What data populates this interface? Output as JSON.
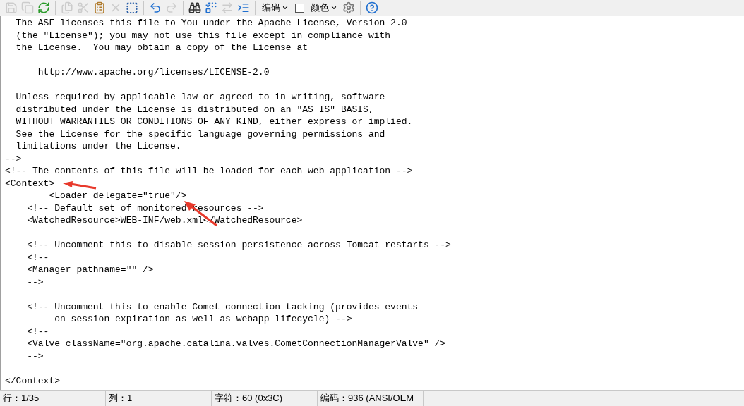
{
  "toolbar": [
    {
      "kind": "button",
      "disabled": true
    },
    {
      "kind": "button",
      "disabled": true
    },
    {
      "kind": "button",
      "disabled": false
    },
    {
      "kind": "separator"
    },
    {
      "kind": "button",
      "disabled": true
    },
    {
      "kind": "button",
      "disabled": true
    },
    {
      "kind": "button",
      "disabled": false
    },
    {
      "kind": "button",
      "disabled": true
    },
    {
      "kind": "button",
      "disabled": false
    },
    {
      "kind": "separator"
    },
    {
      "kind": "button",
      "disabled": false
    },
    {
      "kind": "button",
      "disabled": true
    },
    {
      "kind": "separator"
    },
    {
      "kind": "button",
      "disabled": false
    },
    {
      "kind": "button",
      "disabled": false
    },
    {
      "kind": "button",
      "disabled": true
    },
    {
      "kind": "button",
      "disabled": false
    },
    {
      "kind": "separator"
    },
    {
      "kind": "dropdown",
      "label": "编码"
    },
    {
      "kind": "checkbox",
      "checked": false
    },
    {
      "kind": "dropdown",
      "label": "颜色"
    },
    {
      "kind": "button",
      "disabled": false
    },
    {
      "kind": "separator"
    },
    {
      "kind": "button",
      "disabled": false
    }
  ],
  "editor": {
    "lines": [
      {
        "text": "  The ASF licenses this file to You under the Apache License, Version 2.0"
      },
      {
        "text": "  (the \"License\"); you may not use this file except in compliance with"
      },
      {
        "text": "  the License.  You may obtain a copy of the License at"
      },
      {
        "kind": "blank"
      },
      {
        "text": "      http://www.apache.org/licenses/LICENSE-2.0"
      },
      {
        "kind": "blank"
      },
      {
        "text": "  Unless required by applicable law or agreed to in writing, software"
      },
      {
        "text": "  distributed under the License is distributed on an \"AS IS\" BASIS,"
      },
      {
        "text": "  WITHOUT WARRANTIES OR CONDITIONS OF ANY KIND, either express or implied."
      },
      {
        "text": "  See the License for the specific language governing permissions and"
      },
      {
        "text": "  limitations under the License."
      },
      {
        "text": "-->"
      },
      {
        "text": "<!-- The contents of this file will be loaded for each web application -->"
      },
      {
        "text": "<Context>"
      },
      {
        "text": "        <Loader delegate=\"true\"/>"
      },
      {
        "text": "    <!-- Default set of monitored resources -->"
      },
      {
        "text": "    <WatchedResource>WEB-INF/web.xml</WatchedResource>"
      },
      {
        "kind": "blank"
      },
      {
        "text": "    <!-- Uncomment this to disable session persistence across Tomcat restarts -->"
      },
      {
        "text": "    <!--"
      },
      {
        "text": "    <Manager pathname=\"\" />"
      },
      {
        "text": "    -->"
      },
      {
        "kind": "blank"
      },
      {
        "text": "    <!-- Uncomment this to enable Comet connection tacking (provides events"
      },
      {
        "text": "         on session expiration as well as webapp lifecycle) -->"
      },
      {
        "text": "    <!--"
      },
      {
        "text": "    <Valve className=\"org.apache.catalina.valves.CometConnectionManagerValve\" />"
      },
      {
        "text": "    -->"
      },
      {
        "kind": "blank"
      },
      {
        "text": "</Context>"
      }
    ]
  },
  "status_bar": [
    "行：1/35",
    "列：1",
    "字符：60 (0x3C)",
    "编码：936  (ANSI/OEM"
  ]
}
